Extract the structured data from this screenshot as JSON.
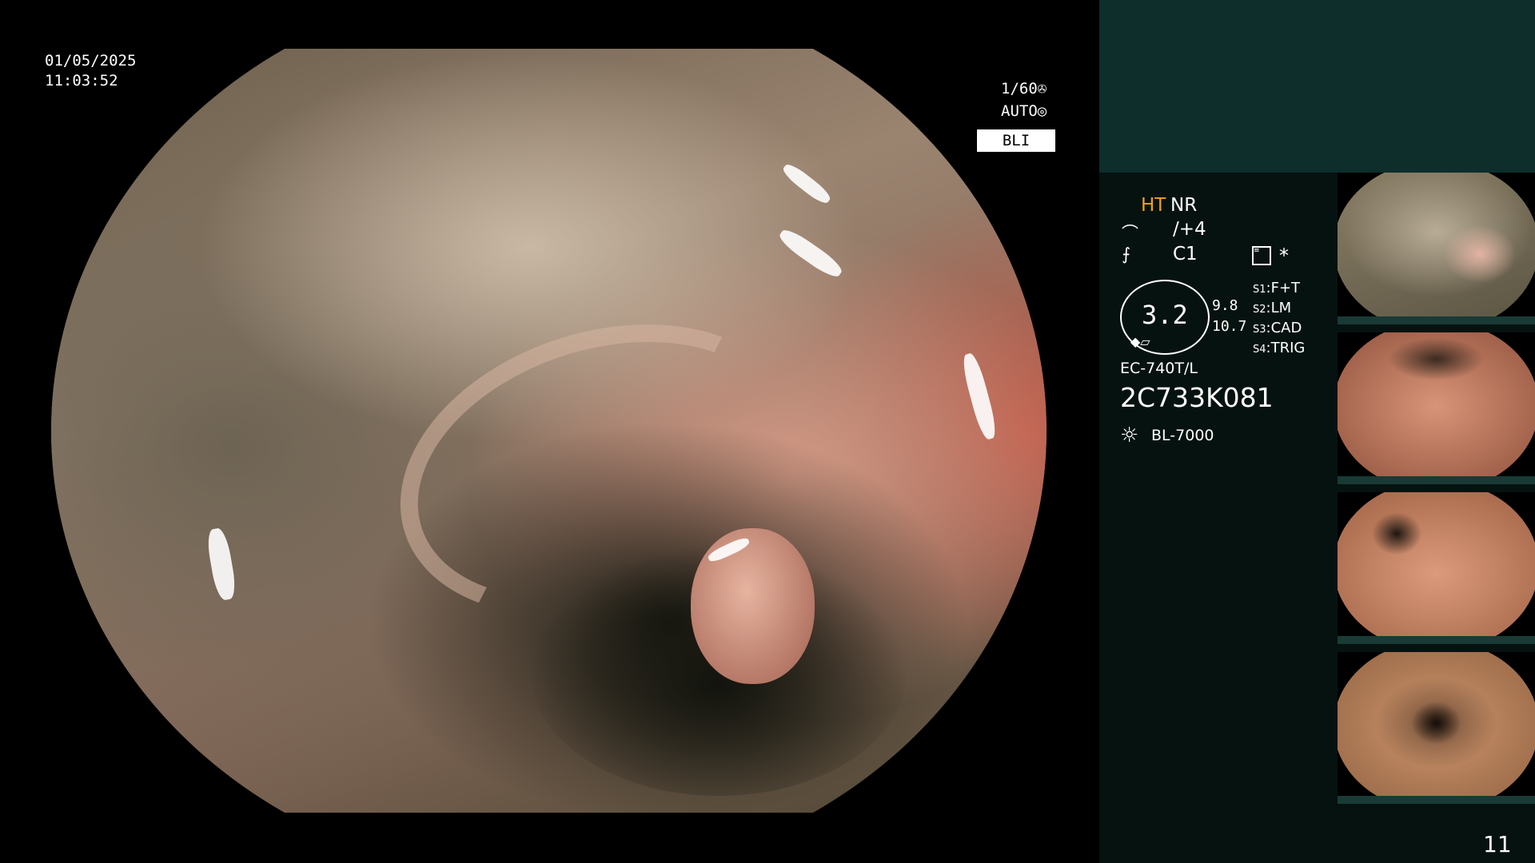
{
  "overlay": {
    "date": "01/05/2025",
    "time": "11:03:52",
    "shutter": "1/60",
    "shutter_icon": "✇",
    "iris": "AUTO",
    "iris_icon": "◎",
    "mode": "BLI"
  },
  "panel": {
    "ht_label": "HT",
    "nr_label": "NR",
    "enhancement_icon": "⌒",
    "enhancement_value": "/+4",
    "color_icon": "⨍",
    "color_value": "C1",
    "grid_icon": "≣",
    "star": "*",
    "dial_value": "3.2",
    "dial_icons": "◆▱",
    "value_top": "9.8",
    "value_bottom": "10.7",
    "scopes": [
      {
        "key": "S1",
        "value": "F+T"
      },
      {
        "key": "S2",
        "value": "LM"
      },
      {
        "key": "S3",
        "value": "CAD"
      },
      {
        "key": "S4",
        "value": "TRIG"
      }
    ],
    "model": "EC-740T/L",
    "serial": "2C733K081",
    "light_icon": "☼",
    "light": "BL-7000"
  },
  "thumbnails": [
    {
      "name": "thumbnail-1"
    },
    {
      "name": "thumbnail-2"
    },
    {
      "name": "thumbnail-3"
    },
    {
      "name": "thumbnail-4"
    }
  ],
  "page_number": "11",
  "colors": {
    "panel_top": "#0d2e2b",
    "panel_bg": "#061210",
    "ht_accent": "#f0a020"
  }
}
